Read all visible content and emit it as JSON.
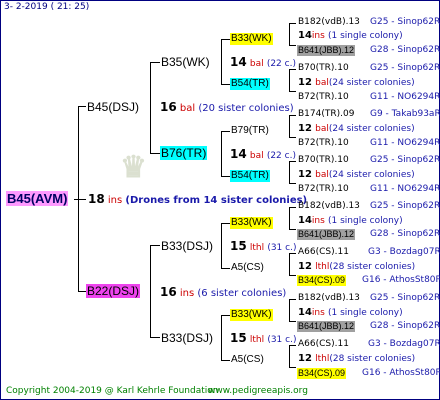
{
  "header": {
    "date_text": "3-  2-2019 ( 21: 25)"
  },
  "footer": {
    "copyright": "Copyright 2004-2019 @ Karl Kehrle Foundation",
    "url": "www.pedigreeapis.org"
  },
  "root": {
    "label": "B45(AVM)",
    "count": "18",
    "ins": "ins",
    "note": "(Drones from 14 sister colonies)"
  },
  "gen1": {
    "upper": {
      "label": "B45(DSJ)",
      "count": "16",
      "ins": "bal",
      "note": "(20 sister colonies)"
    },
    "lower": {
      "label": "B22(DSJ)",
      "count": "16",
      "ins": "ins",
      "note": "(6 sister colonies)"
    }
  },
  "gen2": {
    "a": {
      "label": "B35(WK)",
      "count": "14",
      "ins": "bal",
      "note": "(22 c.)"
    },
    "b": {
      "label": "B76(TR)",
      "count": "14",
      "ins": "bal",
      "note": "(22 c.)"
    },
    "c": {
      "label": "B33(DSJ)",
      "count": "15",
      "ins": "lthl",
      "note": "(31 c.)"
    },
    "d": {
      "label": "B33(DSJ)",
      "count": "15",
      "ins": "lthl",
      "note": "(31 c.)"
    }
  },
  "gen3": [
    {
      "label": "B33(WK)"
    },
    {
      "label": "B54(TR)"
    },
    {
      "label": "B79(TR)"
    },
    {
      "label": "B54(TR)"
    },
    {
      "label": "B33(WK)"
    },
    {
      "label": "A5(CS)"
    },
    {
      "label": "B33(WK)"
    },
    {
      "label": "A5(CS)"
    }
  ],
  "gen4": [
    {
      "top": "B182(vdB).13",
      "top_id": "G25 - Sinop62R",
      "mid_count": "14",
      "mid_ins": "ins",
      "mid_note": "(1 single colony)",
      "bot": "B641(JBB).12",
      "bot_id": "G28 - Sinop62R"
    },
    {
      "top": "B70(TR).10",
      "top_id": "G25 - Sinop62R",
      "mid_count": "12",
      "mid_ins": "bal",
      "mid_note": "(24 sister colonies)",
      "bot": "B72(TR).10",
      "bot_id": "G11 - NO6294R"
    },
    {
      "top": "B174(TR).09",
      "top_id": "G9 - Takab93aR",
      "mid_count": "12",
      "mid_ins": "bal",
      "mid_note": "(24 sister colonies)",
      "bot": "B72(TR).10",
      "bot_id": "G11 - NO6294R"
    },
    {
      "top": "B70(TR).10",
      "top_id": "G25 - Sinop62R",
      "mid_count": "12",
      "mid_ins": "bal",
      "mid_note": "(24 sister colonies)",
      "bot": "B72(TR).10",
      "bot_id": "G11 - NO6294R"
    },
    {
      "top": "B182(vdB).13",
      "top_id": "G25 - Sinop62R",
      "mid_count": "14",
      "mid_ins": "ins",
      "mid_note": "(1 single colony)",
      "bot": "B641(JBB).12",
      "bot_id": "G28 - Sinop62R"
    },
    {
      "top": "A66(CS).11",
      "top_id": "G3 - Bozdag07R",
      "mid_count": "12",
      "mid_ins": "lthl",
      "mid_note": "(28 sister colonies)",
      "bot": "B34(CS).09",
      "bot_id": "G16 - AthosSt80R"
    },
    {
      "top": "B182(vdB).13",
      "top_id": "G25 - Sinop62R",
      "mid_count": "14",
      "mid_ins": "ins",
      "mid_note": "(1 single colony)",
      "bot": "B641(JBB).12",
      "bot_id": "G28 - Sinop62R"
    },
    {
      "top": "A66(CS).11",
      "top_id": "G3 - Bozdag07R",
      "mid_count": "12",
      "mid_ins": "lthl",
      "mid_note": "(28 sister colonies)",
      "bot": "B34(CS).09",
      "bot_id": "G16 - AthosSt80R"
    }
  ]
}
